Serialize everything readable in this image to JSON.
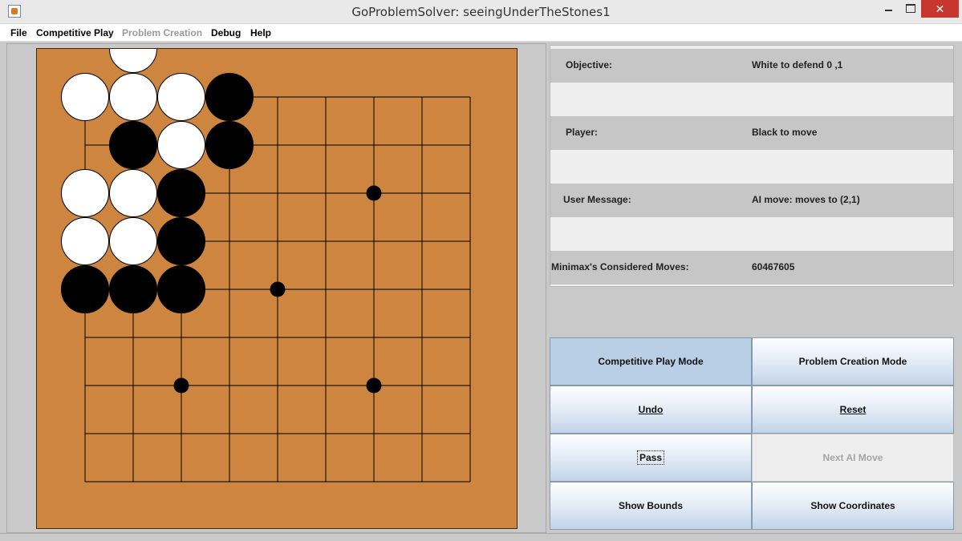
{
  "window": {
    "title": "GoProblemSolver: seeingUnderTheStones1",
    "close_glyph": "✕"
  },
  "menu": [
    {
      "label": "File",
      "enabled": true
    },
    {
      "label": "Competitive Play",
      "enabled": true
    },
    {
      "label": "Problem Creation",
      "enabled": false
    },
    {
      "label": "Debug",
      "enabled": true
    },
    {
      "label": "Help",
      "enabled": true
    }
  ],
  "board": {
    "size": 9,
    "hoshi": [
      [
        6,
        2
      ],
      [
        4,
        4
      ],
      [
        2,
        6
      ],
      [
        6,
        6
      ]
    ],
    "stones": [
      {
        "color": "white",
        "col": 1,
        "row": -1
      },
      {
        "color": "white",
        "col": 0,
        "row": 0
      },
      {
        "color": "white",
        "col": 1,
        "row": 0
      },
      {
        "color": "white",
        "col": 2,
        "row": 0
      },
      {
        "color": "black",
        "col": 3,
        "row": 0
      },
      {
        "color": "black",
        "col": 1,
        "row": 1
      },
      {
        "color": "white",
        "col": 2,
        "row": 1
      },
      {
        "color": "black",
        "col": 3,
        "row": 1
      },
      {
        "color": "white",
        "col": 0,
        "row": 2
      },
      {
        "color": "white",
        "col": 1,
        "row": 2
      },
      {
        "color": "black",
        "col": 2,
        "row": 2
      },
      {
        "color": "white",
        "col": 0,
        "row": 3
      },
      {
        "color": "white",
        "col": 1,
        "row": 3
      },
      {
        "color": "black",
        "col": 2,
        "row": 3
      },
      {
        "color": "black",
        "col": 0,
        "row": 4
      },
      {
        "color": "black",
        "col": 1,
        "row": 4
      },
      {
        "color": "black",
        "col": 2,
        "row": 4
      }
    ],
    "colors": {
      "wood": "#cd853f",
      "line": "#000000",
      "black": "#000000",
      "white": "#ffffff"
    }
  },
  "info": {
    "objective_label": "Objective:",
    "objective_value": "White to defend 0 ,1",
    "player_label": "Player:",
    "player_value": "Black to move",
    "message_label": "User Message:",
    "message_value": "AI move: moves to (2,1)",
    "minimax_label": "Minimax's Considered Moves:",
    "minimax_value": "60467605"
  },
  "buttons": {
    "competitive_mode": "Competitive Play Mode",
    "problem_mode": "Problem Creation Mode",
    "undo": "Undo",
    "reset": "Reset",
    "pass": "Pass",
    "next_ai": "Next AI Move",
    "show_bounds": "Show Bounds",
    "show_coordinates": "Show Coordinates"
  }
}
